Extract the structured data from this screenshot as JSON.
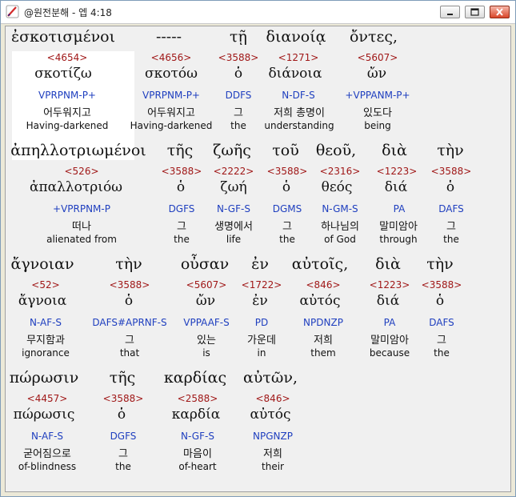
{
  "window": {
    "title": "@원전분해 - 엡 4:18"
  },
  "rows": [
    {
      "words": [
        {
          "greek": "ἐσκοτισμένοι",
          "strong": "<4654>",
          "lemma": "σκοτίζω",
          "morph": "VPRPNM-P+",
          "korean": "어두워지고",
          "english": "Having-darkened"
        },
        {
          "greek": "-----",
          "strong": "<4656>",
          "lemma": "σκοτόω",
          "morph": "VPRPNM-P+",
          "korean": "어두워지고",
          "english": "Having-darkened"
        },
        {
          "greek": "τῇ",
          "strong": "<3588>",
          "lemma": "ὁ",
          "morph": "DDFS",
          "korean": "그",
          "english": "the"
        },
        {
          "greek": "διανοίᾳ",
          "strong": "<1271>",
          "lemma": "διάνοια",
          "morph": "N-DF-S",
          "korean": "저희 총명이",
          "english": "understanding"
        },
        {
          "greek": "ὄντες,",
          "strong": "<5607>",
          "lemma": "ὤν",
          "morph": "+VPPANM-P+",
          "korean": "있도다",
          "english": "being"
        }
      ]
    },
    {
      "words": [
        {
          "greek": "ἀπηλλοτριωμένοι",
          "strong": "<526>",
          "lemma": "ἀπαλλοτριόω",
          "morph": "+VPRPNM-P",
          "korean": "떠나",
          "english": "alienated from"
        },
        {
          "greek": "τῆς",
          "strong": "<3588>",
          "lemma": "ὁ",
          "morph": "DGFS",
          "korean": "그",
          "english": "the"
        },
        {
          "greek": "ζωῆς",
          "strong": "<2222>",
          "lemma": "ζωή",
          "morph": "N-GF-S",
          "korean": "생명에서",
          "english": "life"
        },
        {
          "greek": "τοῦ",
          "strong": "<3588>",
          "lemma": "ὁ",
          "morph": "DGMS",
          "korean": "그",
          "english": "the"
        },
        {
          "greek": "θεοῦ,",
          "strong": "<2316>",
          "lemma": "θεός",
          "morph": "N-GM-S",
          "korean": "하나님의",
          "english": "of God"
        },
        {
          "greek": "διὰ",
          "strong": "<1223>",
          "lemma": "διά",
          "morph": "PA",
          "korean": "말미암아",
          "english": "through"
        },
        {
          "greek": "τὴν",
          "strong": "<3588>",
          "lemma": "ὁ",
          "morph": "DAFS",
          "korean": "그",
          "english": "the"
        }
      ]
    },
    {
      "words": [
        {
          "greek": "ἄγνοιαν",
          "strong": "<52>",
          "lemma": "ἄγνοια",
          "morph": "N-AF-S",
          "korean": "무지함과",
          "english": "ignorance"
        },
        {
          "greek": "τὴν",
          "strong": "<3588>",
          "lemma": "ὁ",
          "morph": "DAFS#APRNF-S",
          "korean": "그",
          "english": "that"
        },
        {
          "greek": "οὖσαν",
          "strong": "<5607>",
          "lemma": "ὤν",
          "morph": "VPPAAF-S",
          "korean": "있는",
          "english": "is"
        },
        {
          "greek": "ἐν",
          "strong": "<1722>",
          "lemma": "ἐν",
          "morph": "PD",
          "korean": "가운데",
          "english": "in"
        },
        {
          "greek": "αὐτοῖς,",
          "strong": "<846>",
          "lemma": "αὐτός",
          "morph": "NPDNZP",
          "korean": "저희",
          "english": "them"
        },
        {
          "greek": "διὰ",
          "strong": "<1223>",
          "lemma": "διά",
          "morph": "PA",
          "korean": "말미암아",
          "english": "because"
        },
        {
          "greek": "τὴν",
          "strong": "<3588>",
          "lemma": "ὁ",
          "morph": "DAFS",
          "korean": "그",
          "english": "the"
        }
      ]
    },
    {
      "words": [
        {
          "greek": "πώρωσιν",
          "strong": "<4457>",
          "lemma": "πώρωσις",
          "morph": "N-AF-S",
          "korean": "굳어짐으로",
          "english": "of-blindness"
        },
        {
          "greek": "τῆς",
          "strong": "<3588>",
          "lemma": "ὁ",
          "morph": "DGFS",
          "korean": "그",
          "english": "the"
        },
        {
          "greek": "καρδίας",
          "strong": "<2588>",
          "lemma": "καρδία",
          "morph": "N-GF-S",
          "korean": "마음이",
          "english": "of-heart"
        },
        {
          "greek": "αὐτῶν,",
          "strong": "<846>",
          "lemma": "αὐτός",
          "morph": "NPGNZP",
          "korean": "저희",
          "english": "their"
        }
      ]
    }
  ]
}
